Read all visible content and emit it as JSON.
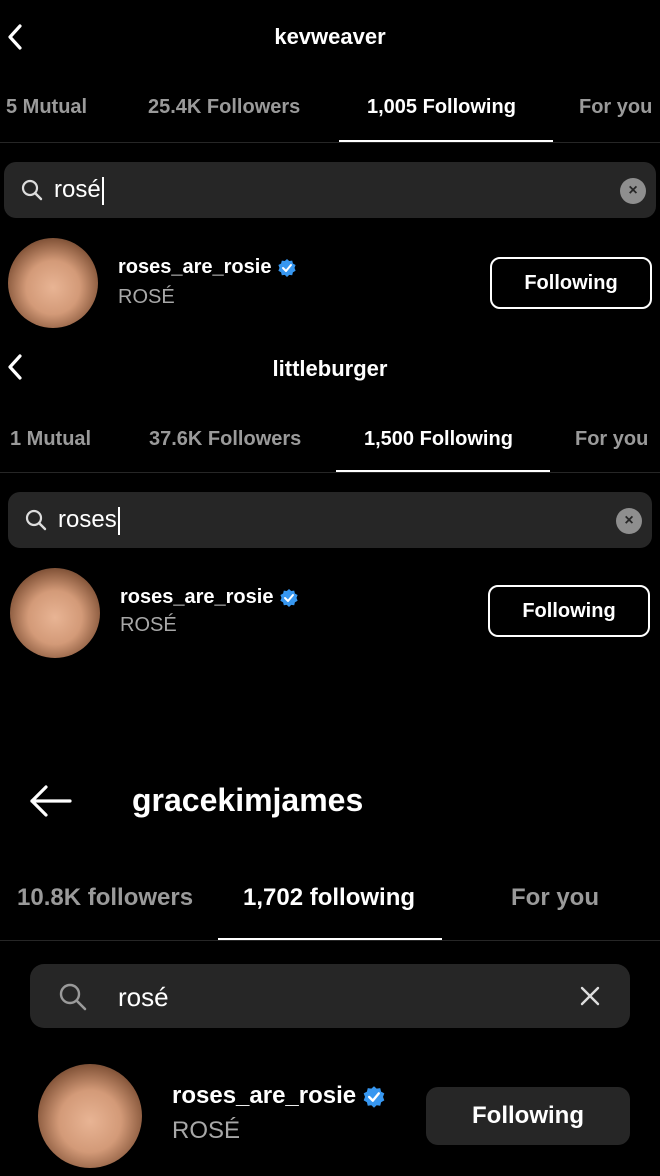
{
  "panels": [
    {
      "title": "kevweaver",
      "tabs": [
        "5 Mutual",
        "25.4K Followers",
        "1,005 Following",
        "For you"
      ],
      "search_value": "rosé",
      "result": {
        "username": "roses_are_rosie",
        "fullname": "ROSÉ",
        "button": "Following"
      }
    },
    {
      "title": "littleburger",
      "tabs": [
        "1 Mutual",
        "37.6K Followers",
        "1,500 Following",
        "For you"
      ],
      "search_value": "roses",
      "result": {
        "username": "roses_are_rosie",
        "fullname": "ROSÉ",
        "button": "Following"
      }
    },
    {
      "title": "gracekimjames",
      "tabs": [
        "10.8K followers",
        "1,702 following",
        "For you"
      ],
      "search_value": "rosé",
      "result": {
        "username": "roses_are_rosie",
        "fullname": "ROSÉ",
        "button": "Following"
      }
    }
  ],
  "icons": {
    "back": "chevron-left-icon",
    "back_arrow": "arrow-left-icon",
    "search": "search-icon",
    "clear": "close-icon",
    "verified": "verified-badge-icon"
  },
  "colors": {
    "verified": "#3797f0",
    "active_tab": "#ffffff",
    "inactive_tab": "#9a9a9a",
    "search_bg": "#262626"
  }
}
